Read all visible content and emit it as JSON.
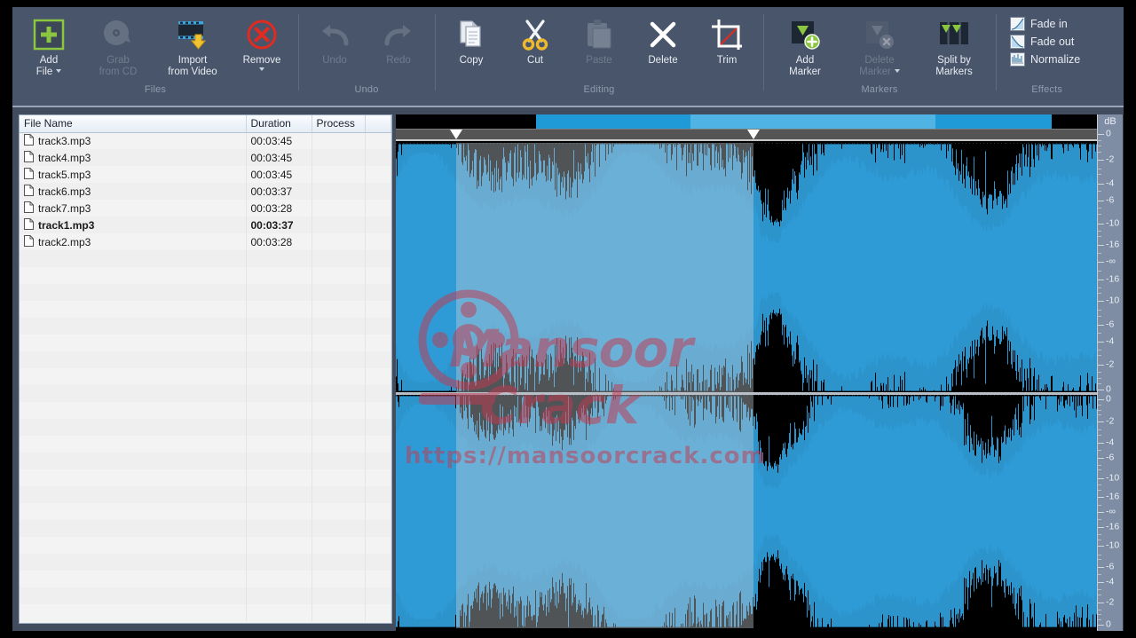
{
  "ribbon": {
    "groups": [
      {
        "label": "Files",
        "buttons": [
          {
            "name": "add-file",
            "label": "Add\nFile",
            "icon": "add-file-icon",
            "disabled": false,
            "caret": true,
            "caret_inline": true
          },
          {
            "name": "grab-from-cd",
            "label": "Grab\nfrom CD",
            "icon": "cd-icon",
            "disabled": true,
            "caret": false
          },
          {
            "name": "import-from-video",
            "label": "Import\nfrom Video",
            "icon": "import-video-icon",
            "disabled": false,
            "caret": false
          },
          {
            "name": "remove",
            "label": "Remove",
            "icon": "remove-icon",
            "disabled": false,
            "caret": true,
            "caret_inline": false
          }
        ]
      },
      {
        "label": "Undo",
        "buttons": [
          {
            "name": "undo",
            "label": "Undo",
            "icon": "undo-arrow-icon",
            "disabled": true,
            "caret": false
          },
          {
            "name": "redo",
            "label": "Redo",
            "icon": "redo-arrow-icon",
            "disabled": true,
            "caret": false
          }
        ]
      },
      {
        "label": "Editing",
        "buttons": [
          {
            "name": "copy",
            "label": "Copy",
            "icon": "copy-icon",
            "disabled": false,
            "caret": false
          },
          {
            "name": "cut",
            "label": "Cut",
            "icon": "scissors-icon",
            "disabled": false,
            "caret": false
          },
          {
            "name": "paste",
            "label": "Paste",
            "icon": "paste-icon",
            "disabled": true,
            "caret": false
          },
          {
            "name": "delete",
            "label": "Delete",
            "icon": "x-cross-icon",
            "disabled": false,
            "caret": false
          },
          {
            "name": "trim",
            "label": "Trim",
            "icon": "crop-icon",
            "disabled": false,
            "caret": false
          }
        ]
      },
      {
        "label": "Markers",
        "buttons": [
          {
            "name": "add-marker",
            "label": "Add\nMarker",
            "icon": "add-marker-icon",
            "disabled": false,
            "caret": false
          },
          {
            "name": "delete-marker",
            "label": "Delete\nMarker",
            "icon": "delete-marker-icon",
            "disabled": true,
            "caret": true,
            "caret_inline": true
          },
          {
            "name": "split-by-markers",
            "label": "Split by\nMarkers",
            "icon": "split-markers-icon",
            "disabled": false,
            "caret": false
          }
        ]
      },
      {
        "label": "Effects",
        "effects": [
          {
            "name": "fade-in",
            "label": "Fade in",
            "icon": "fade-in-icon"
          },
          {
            "name": "fade-out",
            "label": "Fade out",
            "icon": "fade-out-icon"
          },
          {
            "name": "normalize",
            "label": "Normalize",
            "icon": "normalize-icon"
          }
        ]
      }
    ]
  },
  "file_list": {
    "columns": [
      "File Name",
      "Duration",
      "Process"
    ],
    "rows": [
      {
        "name": "track3.mp3",
        "duration": "00:03:45",
        "process": "",
        "selected": false
      },
      {
        "name": "track4.mp3",
        "duration": "00:03:45",
        "process": "",
        "selected": false
      },
      {
        "name": "track5.mp3",
        "duration": "00:03:45",
        "process": "",
        "selected": false
      },
      {
        "name": "track6.mp3",
        "duration": "00:03:37",
        "process": "",
        "selected": false
      },
      {
        "name": "track7.mp3",
        "duration": "00:03:28",
        "process": "",
        "selected": false
      },
      {
        "name": "track1.mp3",
        "duration": "00:03:37",
        "process": "",
        "selected": true
      },
      {
        "name": "track2.mp3",
        "duration": "00:03:28",
        "process": "",
        "selected": false
      }
    ],
    "empty_row_count": 22
  },
  "waveform": {
    "db_header": "dB",
    "db_labels": [
      "0",
      "-2",
      "-4",
      "-6",
      "-10",
      "-16",
      "-∞",
      "-16",
      "-10",
      "-6",
      "-4",
      "-2",
      "0"
    ],
    "channel_count": 2,
    "selection": {
      "start_pct": 8.6,
      "end_pct": 51.0
    },
    "overview": {
      "sel_start_pct": 20.0,
      "sel_mid_pct": 42.0,
      "sel_end_pct": 93.5
    },
    "markers_pct": [
      8.6,
      51.0
    ],
    "colors": {
      "wave": "#2e9bd6",
      "background": "#000000",
      "selection_tint": "#c8d2da",
      "overview_sel": "#1f9ad6"
    }
  },
  "watermark": {
    "line1": "Mansoor",
    "line2": "Crack",
    "url": "https://mansoorcrack.com"
  }
}
